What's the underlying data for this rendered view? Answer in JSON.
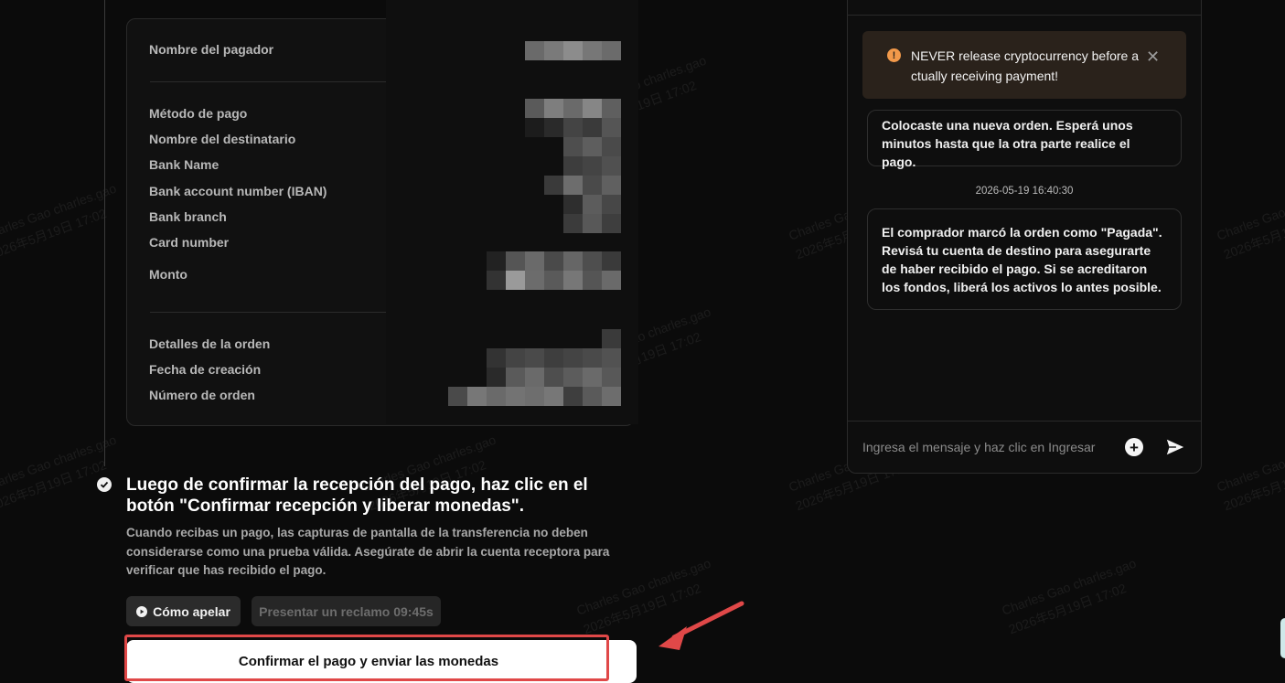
{
  "order_card": {
    "payer_name_label": "Nombre del pagador",
    "payment_method_label": "Método de pago",
    "recipient_name_label": "Nombre del destinatario",
    "bank_name_label": "Bank Name",
    "iban_label": "Bank account number (IBAN)",
    "bank_branch_label": "Bank branch",
    "card_number_label": "Card number",
    "amount_label": "Monto",
    "order_details_label": "Detalles de la orden",
    "creation_date_label": "Fecha de creación",
    "order_number_label": "Número de orden"
  },
  "step": {
    "title": "Luego de confirmar la recepción del pago, haz clic en el botón \"Confirmar recepción y liberar monedas\".",
    "description": "Cuando recibas un pago, las capturas de pantalla de la transferencia no deben considerarse como una prueba válida. Asegúrate de abrir la cuenta receptora para verificar que has recibido el pago."
  },
  "buttons": {
    "appeal_label": "Cómo apelar",
    "claim_label": "Presentar un reclamo 09:45s",
    "confirm_label": "Confirmar el pago y enviar las monedas"
  },
  "chat": {
    "warning_text": "NEVER release cryptocurrency before a ctually receiving payment!",
    "message_1": "Colocaste una nueva orden. Esperá unos minutos hasta que la otra parte realice el pago.",
    "timestamp": "2026-05-19 16:40:30",
    "message_2": "El comprador marcó la orden como \"Pagada\". Revisá tu cuenta de destino para asegurarte de haber recibido el pago. Si se acreditaron los fondos, liberá los activos lo antes posible.",
    "input_placeholder": "Ingresa el mensaje y haz clic en Ingresar"
  },
  "watermark": {
    "name": "Charles Gao charles.gao",
    "date": "2026年5月19日 17:02"
  },
  "colors": {
    "background": "#0b0b0b",
    "warning_bg": "#2a221b",
    "warning_icon": "#f2994a",
    "highlight": "#e04848",
    "arrow": "#e04848"
  }
}
